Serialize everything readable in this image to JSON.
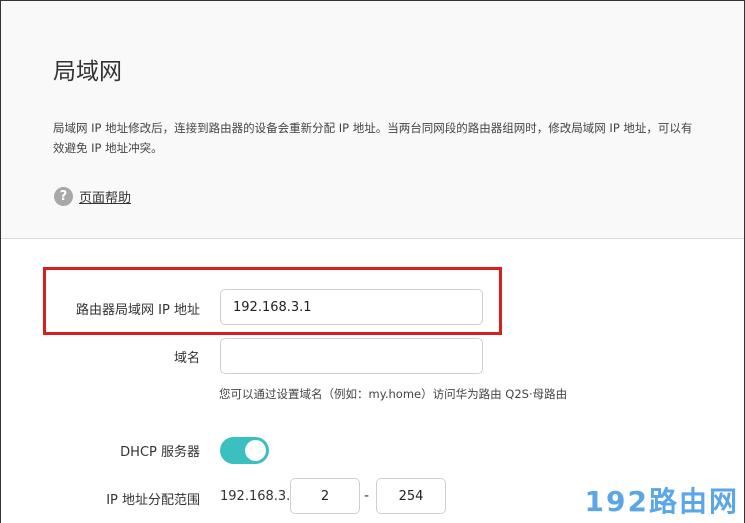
{
  "page": {
    "title": "局域网",
    "description": "局域网 IP 地址修改后，连接到路由器的设备会重新分配 IP 地址。当两台同网段的路由器组网时，修改局域网 IP 地址，可以有效避免 IP 地址冲突。",
    "help_icon": "?",
    "help_label": "页面帮助"
  },
  "form": {
    "lan_ip_label": "路由器局域网 IP 地址",
    "lan_ip_value": "192.168.3.1",
    "domain_label": "域名",
    "domain_value": "",
    "domain_hint": "您可以通过设置域名（例如：my.home）访问华为路由 Q2S·母路由",
    "dhcp_label": "DHCP 服务器",
    "dhcp_enabled": true,
    "range_label": "IP 地址分配范围",
    "range_prefix": "192.168.3.",
    "range_start": "2",
    "range_separator": "-",
    "range_end": "254"
  },
  "colors": {
    "highlight": "#d81e1e",
    "toggle_on": "#3bbfbf",
    "watermark": "#5aa6e6"
  },
  "watermark": "192路由网"
}
